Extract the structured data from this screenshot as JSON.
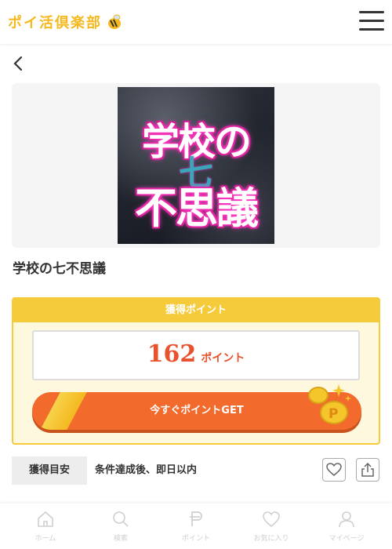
{
  "header": {
    "logo_text": "ポイ活倶楽部"
  },
  "hero": {
    "image_text_line1": "学校の",
    "image_text_seven": "七",
    "image_text_line2": "不思議"
  },
  "offer": {
    "title": "学校の七不思議"
  },
  "points": {
    "header": "獲得ポイント",
    "value": "162",
    "unit": "ポイント",
    "cta": "今すぐポイントGET"
  },
  "estimate": {
    "label": "獲得目安",
    "value": "条件達成後、即日以内"
  },
  "nav": [
    {
      "label": "ホーム",
      "icon": "home-icon"
    },
    {
      "label": "検索",
      "icon": "search-icon"
    },
    {
      "label": "ポイント",
      "icon": "point-icon"
    },
    {
      "label": "お気に入り",
      "icon": "heart-icon"
    },
    {
      "label": "マイページ",
      "icon": "user-icon"
    }
  ],
  "colors": {
    "accent_orange": "#f26a2c",
    "accent_yellow": "#f5cb3c",
    "points_red": "#e8522d"
  }
}
